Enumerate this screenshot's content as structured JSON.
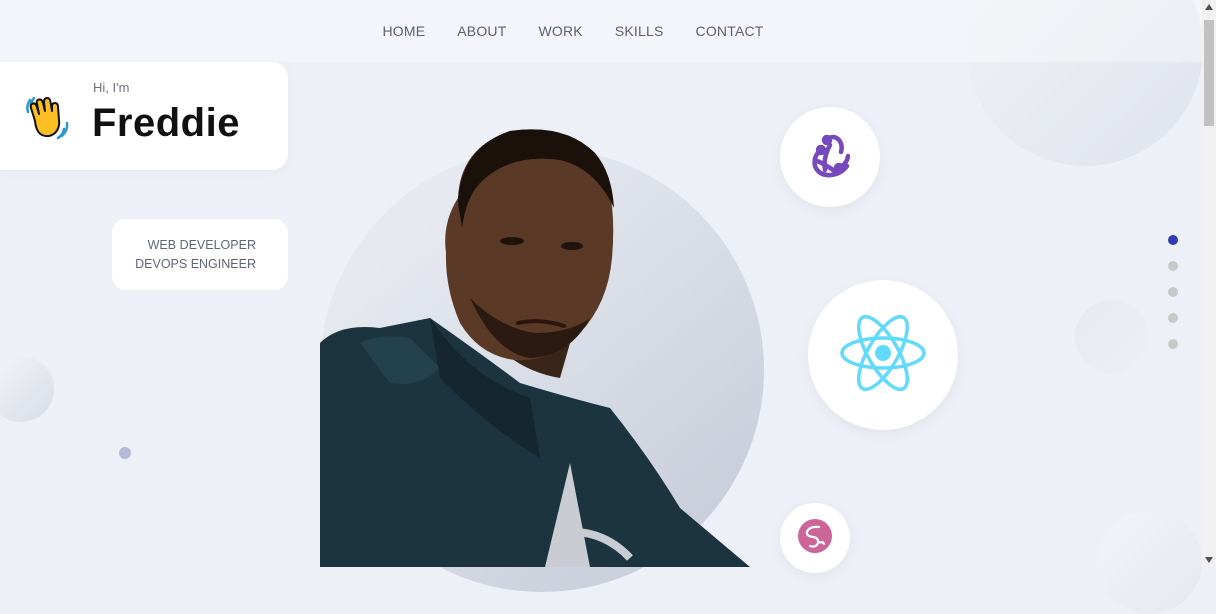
{
  "nav": {
    "items": [
      {
        "label": "HOME"
      },
      {
        "label": "ABOUT"
      },
      {
        "label": "WORK"
      },
      {
        "label": "SKILLS"
      },
      {
        "label": "CONTACT"
      }
    ]
  },
  "hero": {
    "greeting": "Hi, I'm",
    "name": "Freddie",
    "roles": [
      "WEB DEVELOPER",
      "DEVOPS ENGINEER"
    ]
  },
  "skills": [
    {
      "icon": "redux-icon",
      "color": "#764abc"
    },
    {
      "icon": "react-icon",
      "color": "#61dafb"
    },
    {
      "icon": "sass-icon",
      "color": "#cc6699"
    }
  ],
  "pagination": {
    "count": 5,
    "active_index": 0
  },
  "colors": {
    "background": "#edf0f7",
    "accent": "#313bac",
    "dot_inactive": "#c8c8c8"
  }
}
